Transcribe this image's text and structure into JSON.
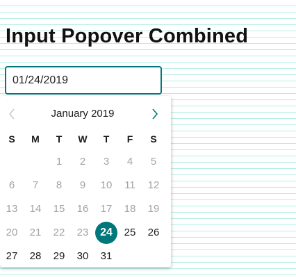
{
  "title": "Input Popover Combined",
  "input": {
    "value": "01/24/2019"
  },
  "calendar": {
    "month_label": "January 2019",
    "weekdays": [
      "S",
      "M",
      "T",
      "W",
      "T",
      "F",
      "S"
    ],
    "weeks": [
      [
        "",
        "",
        "1",
        "2",
        "3",
        "4",
        "5"
      ],
      [
        "6",
        "7",
        "8",
        "9",
        "10",
        "11",
        "12"
      ],
      [
        "13",
        "14",
        "15",
        "16",
        "17",
        "18",
        "19"
      ],
      [
        "20",
        "21",
        "22",
        "23",
        "24",
        "25",
        "26"
      ],
      [
        "27",
        "28",
        "29",
        "30",
        "31",
        "",
        ""
      ]
    ],
    "selected_day": "24",
    "enabled_from_day": 24,
    "prev_icon": "chevron-left-icon",
    "next_icon": "chevron-right-icon"
  },
  "colors": {
    "accent": "#00777a",
    "stripes": "#b5efe3",
    "muted_text": "#a3a3a3",
    "prev_disabled": "#c4c4c4"
  }
}
